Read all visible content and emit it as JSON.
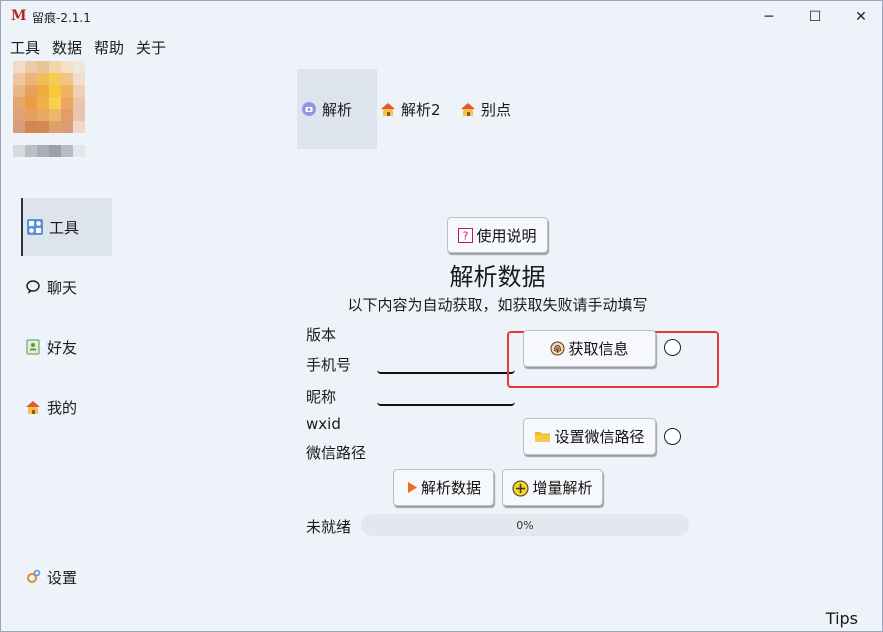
{
  "window": {
    "logo": "M",
    "title": "留痕-2.1.1",
    "minimize_glyph": "─",
    "maximize_glyph": "☐",
    "close_glyph": "✕"
  },
  "menu": {
    "items": [
      {
        "label": "工具"
      },
      {
        "label": "数据"
      },
      {
        "label": "帮助"
      },
      {
        "label": "关于"
      }
    ]
  },
  "sidebar": {
    "items": [
      {
        "label": "工具",
        "icon": "tools-icon",
        "active": true
      },
      {
        "label": "聊天",
        "icon": "chat-icon",
        "active": false
      },
      {
        "label": "好友",
        "icon": "contacts-icon",
        "active": false
      },
      {
        "label": "我的",
        "icon": "home-icon",
        "active": false
      }
    ],
    "settings_label": "设置"
  },
  "tabs": [
    {
      "label": "解析",
      "icon": "parse-icon",
      "active": true
    },
    {
      "label": "解析2",
      "icon": "house-icon",
      "active": false
    },
    {
      "label": "别点",
      "icon": "house-icon",
      "active": false
    }
  ],
  "main": {
    "help_button": "使用说明",
    "heading": "解析数据",
    "subheading": "以下内容为自动获取，如获取失败请手动填写",
    "labels": {
      "version": "版本",
      "phone": "手机号",
      "nickname": "昵称",
      "wxid": "wxid",
      "wechat_path": "微信路径"
    },
    "inputs": {
      "phone_value": "",
      "nickname_value": ""
    },
    "get_info_button": "获取信息",
    "set_path_button": "设置微信路径",
    "parse_button": "解析数据",
    "incremental_button": "增量解析",
    "status_label": "未就绪",
    "progress_text": "0%",
    "progress": 0
  },
  "footer": {
    "tips": "Tips"
  },
  "colors": {
    "background": "#eef3fa",
    "active_bg": "#dde4ee",
    "highlight_border": "#e53935",
    "logo": "#b3261e"
  }
}
